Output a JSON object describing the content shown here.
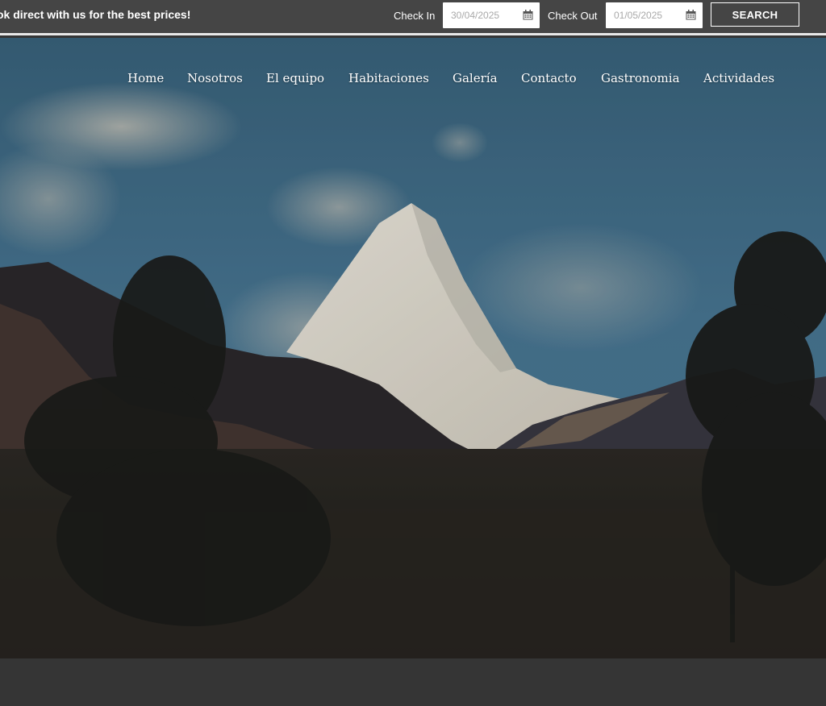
{
  "topbar": {
    "promo_text": "ok direct with us for the best prices!",
    "check_in_label": "Check In",
    "check_in_value": "30/04/2025",
    "check_out_label": "Check Out",
    "check_out_value": "01/05/2025",
    "search_label": "SEARCH",
    "calendar_icon": "calendar-icon"
  },
  "nav": {
    "items": [
      {
        "label": "Home"
      },
      {
        "label": "Nosotros"
      },
      {
        "label": "El equipo"
      },
      {
        "label": "Habitaciones"
      },
      {
        "label": "Galería"
      },
      {
        "label": "Contacto"
      },
      {
        "label": "Gastronomia"
      },
      {
        "label": "Actividades"
      }
    ]
  },
  "colors": {
    "topbar_bg": "#454545",
    "page_bg": "#353535",
    "sky": "#3f6f8e"
  }
}
